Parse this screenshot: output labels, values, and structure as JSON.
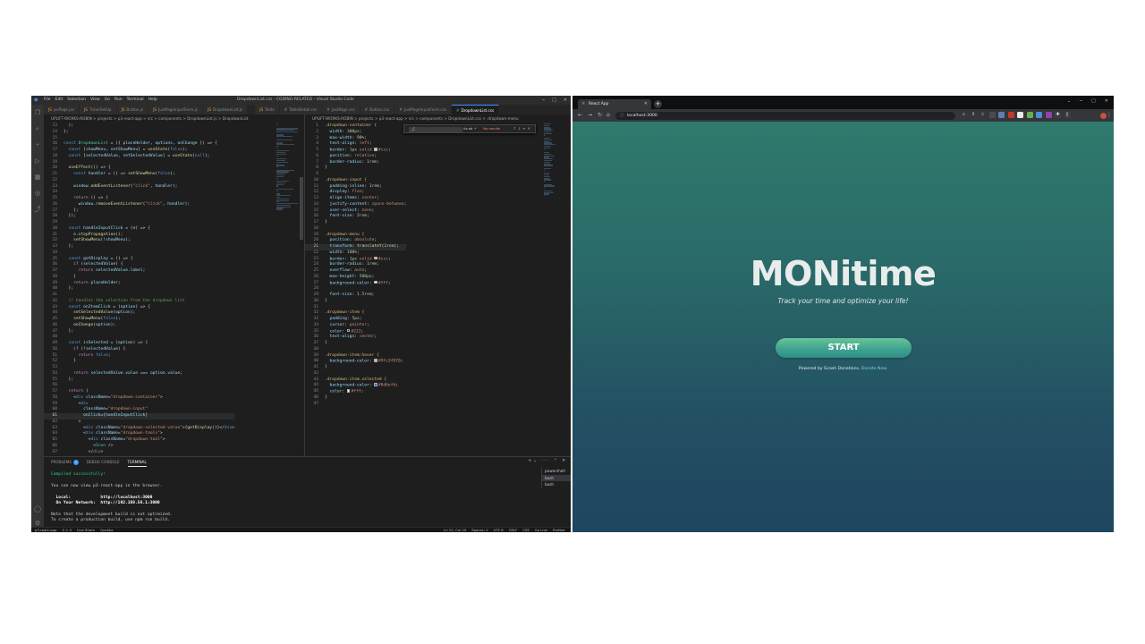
{
  "vscode": {
    "window_title": "DropdownList.css - CODING-RELATED - Visual Studio Code",
    "menu": [
      "File",
      "Edit",
      "Selection",
      "View",
      "Go",
      "Run",
      "Terminal",
      "Help"
    ],
    "tabs": [
      {
        "label": "jsxPage.jsx"
      },
      {
        "label": "TimerSetUp"
      },
      {
        "label": "Button.js"
      },
      {
        "label": "JustPageInputForm.js"
      },
      {
        "label": "DropdownList.js"
      },
      {
        "label": "Tests"
      },
      {
        "label": "TableDetail.css"
      },
      {
        "label": "JustPage.css"
      },
      {
        "label": "Button.css"
      },
      {
        "label": "JustPageInputForm.css"
      },
      {
        "label": "DropdownList.css"
      }
    ],
    "left_breadcrumb": "UPLIFT-WORKS-ROBIN > projects > p3-react-app > src > components > DropdownList.js > DropdownList",
    "right_breadcrumb": "UPLIFT-WORKS-ROBIN > projects > p3-react-app > src > components > DropdownList.css > .dropdown-menu",
    "find": {
      "query": "_C",
      "options": "Aa ab .*",
      "result": "No results"
    },
    "left_code": [
      {
        "n": "13",
        "t": "  );"
      },
      {
        "n": "14",
        "t": "};"
      },
      {
        "n": "15",
        "t": ""
      },
      {
        "n": "16",
        "t": "const DropdownList = ({ placeHolder, options, onChange }) => {"
      },
      {
        "n": "17",
        "t": "  const [showMenu, setShowMenu] = useState(false);"
      },
      {
        "n": "18",
        "t": "  const [selectedValue, setSelectedValue] = useState(null);"
      },
      {
        "n": "19",
        "t": ""
      },
      {
        "n": "20",
        "t": "  useEffect(() => {"
      },
      {
        "n": "21",
        "t": "    const handler = () => setShowMenu(false);"
      },
      {
        "n": "22",
        "t": ""
      },
      {
        "n": "23",
        "t": "    window.addEventListener(\"click\", handler);"
      },
      {
        "n": "24",
        "t": ""
      },
      {
        "n": "25",
        "t": "    return () => {"
      },
      {
        "n": "26",
        "t": "      window.removeEventListener(\"click\", handler);"
      },
      {
        "n": "27",
        "t": "    };"
      },
      {
        "n": "28",
        "t": "  });"
      },
      {
        "n": "29",
        "t": ""
      },
      {
        "n": "30",
        "t": "  const handleInputClick = (e) => {"
      },
      {
        "n": "31",
        "t": "    e.stopPropagation();"
      },
      {
        "n": "32",
        "t": "    setShowMenu(!showMenu);"
      },
      {
        "n": "33",
        "t": "  };"
      },
      {
        "n": "34",
        "t": ""
      },
      {
        "n": "35",
        "t": "  const getDisplay = () => {"
      },
      {
        "n": "36",
        "t": "    if (selectedValue) {"
      },
      {
        "n": "37",
        "t": "      return selectedValue.label;"
      },
      {
        "n": "38",
        "t": "    }"
      },
      {
        "n": "39",
        "t": "    return placeHolder;"
      },
      {
        "n": "40",
        "t": "  };"
      },
      {
        "n": "41",
        "t": ""
      },
      {
        "n": "42",
        "t": "  // handles the selection from the dropdown list"
      },
      {
        "n": "43",
        "t": "  const onItemClick = (option) => {"
      },
      {
        "n": "44",
        "t": "    setSelectedValue(option);"
      },
      {
        "n": "45",
        "t": "    setShowMenu(false);"
      },
      {
        "n": "46",
        "t": "    onChange(option);"
      },
      {
        "n": "47",
        "t": "  };"
      },
      {
        "n": "48",
        "t": ""
      },
      {
        "n": "49",
        "t": "  const isSelected = (option) => {"
      },
      {
        "n": "50",
        "t": "    if (!selectedValue) {"
      },
      {
        "n": "51",
        "t": "      return false;"
      },
      {
        "n": "52",
        "t": "    }"
      },
      {
        "n": "53",
        "t": ""
      },
      {
        "n": "54",
        "t": "    return selectedValue.value === option.value;"
      },
      {
        "n": "55",
        "t": "  };"
      },
      {
        "n": "56",
        "t": ""
      },
      {
        "n": "57",
        "t": "  return ("
      },
      {
        "n": "58",
        "t": "    <div className=\"dropdown-container\">"
      },
      {
        "n": "59",
        "t": "      <div"
      },
      {
        "n": "60",
        "t": "        className=\"dropdown-input\""
      },
      {
        "n": "61",
        "t": "        onClick={handleInputClick}"
      },
      {
        "n": "62",
        "t": "      >"
      },
      {
        "n": "63",
        "t": "        <div className=\"dropdown-selected-value\">{getDisplay()}</div>"
      },
      {
        "n": "64",
        "t": "        <div className=\"dropdown-tools\">"
      },
      {
        "n": "65",
        "t": "          <div className=\"dropdown-tool\">"
      },
      {
        "n": "66",
        "t": "            <Icon />"
      },
      {
        "n": "67",
        "t": "          </div>"
      }
    ],
    "right_code": [
      {
        "n": "1",
        "t": ".dropdown-container {"
      },
      {
        "n": "2",
        "t": "  width: 300px;"
      },
      {
        "n": "3",
        "t": "  max-width: 90%;"
      },
      {
        "n": "4",
        "t": "  text-align: left;"
      },
      {
        "n": "5",
        "t": "  border: 1px solid #ccc;"
      },
      {
        "n": "6",
        "t": "  position: relative;"
      },
      {
        "n": "7",
        "t": "  border-radius: 1rem;"
      },
      {
        "n": "8",
        "t": "}"
      },
      {
        "n": "9",
        "t": ""
      },
      {
        "n": "10",
        "t": ".dropdown-input {"
      },
      {
        "n": "11",
        "t": "  padding-inline: 1rem;"
      },
      {
        "n": "12",
        "t": "  display: flex;"
      },
      {
        "n": "13",
        "t": "  align-items: center;"
      },
      {
        "n": "14",
        "t": "  justify-content: space-between;"
      },
      {
        "n": "15",
        "t": "  user-select: none;"
      },
      {
        "n": "16",
        "t": "  font-size: 2rem;"
      },
      {
        "n": "17",
        "t": "}"
      },
      {
        "n": "18",
        "t": ""
      },
      {
        "n": "19",
        "t": ".dropdown-menu {"
      },
      {
        "n": "20",
        "t": "  position: absolute;"
      },
      {
        "n": "21",
        "t": "  transform: translateY(2rem);"
      },
      {
        "n": "22",
        "t": "  width: 100%;"
      },
      {
        "n": "23",
        "t": "  border: 1px solid #ccc;"
      },
      {
        "n": "24",
        "t": "  border-radius: 1rem;"
      },
      {
        "n": "25",
        "t": "  overflow: auto;"
      },
      {
        "n": "26",
        "t": "  max-height: 500px;"
      },
      {
        "n": "27",
        "t": "  background-color: #fff;"
      },
      {
        "n": "28",
        "t": ""
      },
      {
        "n": "29",
        "t": "  font-size: 1.5rem;"
      },
      {
        "n": "30",
        "t": "}"
      },
      {
        "n": "31",
        "t": ""
      },
      {
        "n": "32",
        "t": ".dropdown-item {"
      },
      {
        "n": "33",
        "t": "  padding: 5px;"
      },
      {
        "n": "34",
        "t": "  cursor: pointer;"
      },
      {
        "n": "35",
        "t": "  color: #222;"
      },
      {
        "n": "36",
        "t": "  text-align: center;"
      },
      {
        "n": "37",
        "t": "}"
      },
      {
        "n": "38",
        "t": ""
      },
      {
        "n": "39",
        "t": ".dropdown-item:hover {"
      },
      {
        "n": "40",
        "t": "  background-color: #9fc3f870;"
      },
      {
        "n": "41",
        "t": "}"
      },
      {
        "n": "42",
        "t": ""
      },
      {
        "n": "43",
        "t": ".dropdown-item.selected {"
      },
      {
        "n": "44",
        "t": "  background-color: #0d6efd;"
      },
      {
        "n": "45",
        "t": "  color: #fff;"
      },
      {
        "n": "46",
        "t": "}"
      },
      {
        "n": "47",
        "t": ""
      }
    ],
    "panel_tabs": [
      "PROBLEMS",
      "DEBUG CONSOLE",
      "TERMINAL"
    ],
    "problems_count": "2",
    "terminal_lines": [
      "Compiled successfully!",
      "",
      "You can now view p3-react-app in the browser.",
      "",
      "  Local:            http://localhost:3000",
      "  On Your Network:  http://192.168.56.1:3000",
      "",
      "Note that the development build is not optimized.",
      "To create a production build, use npm run build."
    ],
    "shells": [
      "powershell",
      "bash",
      "bash"
    ],
    "status_left": [
      "p3-react-app",
      "0 ⚠ 0",
      "Live Share",
      "Quokka"
    ],
    "status_right": [
      "Ln 21, Col 29",
      "Spaces: 2",
      "UTF-8",
      "CRLF",
      "CSS",
      "Go Live",
      "Prettier"
    ]
  },
  "browser": {
    "tab_title": "React App",
    "url": "localhost:3000",
    "page": {
      "title": "MONitime",
      "subtitle": "Track your time and optimize your life!",
      "start_label": "START",
      "powered_text": "Powered by Gcash Donations.",
      "donate_link": "Donate Now."
    }
  },
  "colors": {
    "vscode_bg": "#1e1e1e",
    "accent_blue": "#3794ff",
    "app_gradient_top": "#2f7a6d",
    "app_gradient_bottom": "#1f4660",
    "start_button": "#4fb393"
  }
}
